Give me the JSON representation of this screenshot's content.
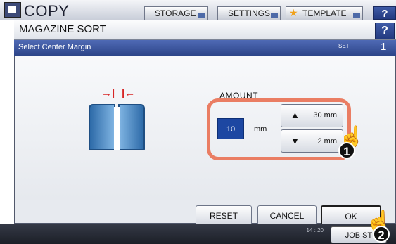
{
  "app": {
    "title": "COPY",
    "tabs": [
      {
        "label": "STORAGE"
      },
      {
        "label": "SETTINGS"
      },
      {
        "label": "TEMPLATE"
      }
    ],
    "help_label": "?"
  },
  "dialog": {
    "title": "MAGAZINE SORT",
    "help_label": "?",
    "subtitle": "Select Center Margin",
    "set_label": "SET",
    "page_number": "1",
    "amount_label": "AMOUNT",
    "amount_value": "10",
    "amount_unit": "mm",
    "up_button": {
      "label": "30 mm"
    },
    "down_button": {
      "label": "2 mm"
    },
    "buttons": {
      "reset": "RESET",
      "cancel": "CANCEL",
      "ok": "OK"
    }
  },
  "status": {
    "date": "",
    "time": "14 : 20",
    "job_status_label": "JOB ST"
  },
  "callouts": {
    "step1": "1",
    "step2": "2"
  },
  "icons": {
    "book": "book-icon",
    "left_arrow": "arrow-right-icon",
    "right_arrow": "arrow-left-icon",
    "up": "triangle-up-icon",
    "down": "triangle-down-icon",
    "hand": "hand-pointer-icon"
  },
  "colors": {
    "accent": "#2d4589",
    "highlight_frame": "#ea7d63",
    "value_box": "#1d47a2",
    "book_blue": "#2d6aa8",
    "margin_arrows": "#d72626"
  }
}
